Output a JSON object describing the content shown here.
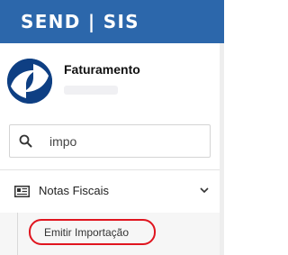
{
  "header": {
    "brand": "SEND | SIS"
  },
  "user": {
    "name": "Faturamento"
  },
  "search": {
    "value": "impo"
  },
  "menu": {
    "items": [
      {
        "label": "Notas Fiscais",
        "icon": "document-icon",
        "expanded": true,
        "children": [
          {
            "label": "Emitir Importação"
          }
        ]
      }
    ]
  },
  "colors": {
    "header_bg": "#2c67ab",
    "avatar_bg": "#0e3f83",
    "highlight_outline": "#e0151f"
  }
}
